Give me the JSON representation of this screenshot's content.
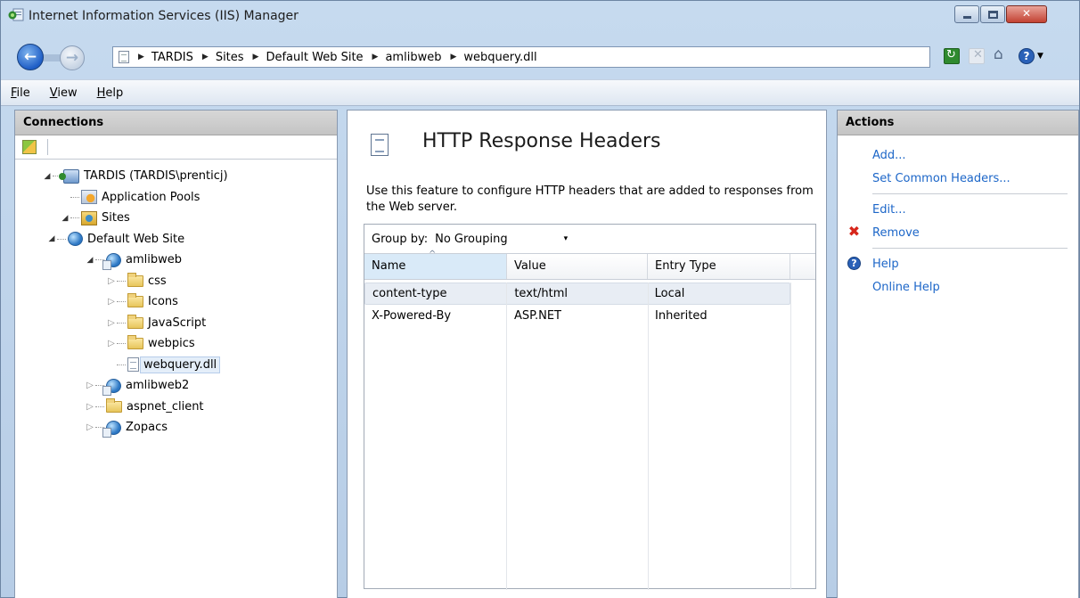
{
  "window": {
    "title": "Internet Information Services (IIS) Manager",
    "controls": {
      "minimize": "",
      "maximize": "",
      "close": "✕"
    }
  },
  "nav": {
    "back_glyph": "←",
    "forward_glyph": "→",
    "breadcrumbs": [
      "TARDIS",
      "Sites",
      "Default Web Site",
      "amlibweb",
      "webquery.dll"
    ],
    "separator_glyph": "▶",
    "tools": [
      "refresh-icon",
      "stop-icon",
      "home-icon",
      "help-icon"
    ]
  },
  "menu": {
    "items": [
      "File",
      "View",
      "Help"
    ],
    "accelerators": [
      "F",
      "V",
      "H"
    ]
  },
  "connections": {
    "header": "Connections",
    "tree": [
      {
        "label": "TARDIS (TARDIS\\prenticj)",
        "indent": 0,
        "twisty": "open",
        "icon": "server"
      },
      {
        "label": "Application Pools",
        "indent": 1,
        "twisty": "none",
        "icon": "pool"
      },
      {
        "label": "Sites",
        "indent": 1,
        "twisty": "open",
        "icon": "sites"
      },
      {
        "label": "Default Web Site",
        "indent": 2,
        "twisty": "open",
        "icon": "globe"
      },
      {
        "label": "amlibweb",
        "indent": 3,
        "twisty": "open",
        "icon": "app"
      },
      {
        "label": "css",
        "indent": 4,
        "twisty": "closed",
        "icon": "folder"
      },
      {
        "label": "Icons",
        "indent": 4,
        "twisty": "closed",
        "icon": "folder"
      },
      {
        "label": "JavaScript",
        "indent": 4,
        "twisty": "closed",
        "icon": "folder"
      },
      {
        "label": "webpics",
        "indent": 4,
        "twisty": "closed",
        "icon": "folder"
      },
      {
        "label": "webquery.dll",
        "indent": 4,
        "twisty": "none",
        "icon": "file",
        "selected": true
      },
      {
        "label": "amlibweb2",
        "indent": 3,
        "twisty": "closed",
        "icon": "app"
      },
      {
        "label": "aspnet_client",
        "indent": 3,
        "twisty": "closed",
        "icon": "folder"
      },
      {
        "label": "Zopacs",
        "indent": 3,
        "twisty": "closed",
        "icon": "app"
      }
    ]
  },
  "feature": {
    "title": "HTTP Response Headers",
    "description": "Use this feature to configure HTTP headers that are added to responses from the Web server.",
    "group_by_label": "Group by:",
    "group_by_value": "No Grouping",
    "group_by_caret": "▾",
    "columns": [
      "Name",
      "Value",
      "Entry Type"
    ],
    "rows": [
      {
        "name": "content-type",
        "value": "text/html",
        "entry_type": "Local"
      },
      {
        "name": "X-Powered-By",
        "value": "ASP.NET",
        "entry_type": "Inherited"
      }
    ]
  },
  "actions": {
    "header": "Actions",
    "groups": [
      [
        {
          "label": "Add...",
          "icon": ""
        },
        {
          "label": "Set Common Headers...",
          "icon": ""
        }
      ],
      [
        {
          "label": "Edit...",
          "icon": ""
        },
        {
          "label": "Remove",
          "icon": "remove-icon"
        }
      ],
      [
        {
          "label": "Help",
          "icon": "help-icon"
        },
        {
          "label": "Online Help",
          "icon": ""
        }
      ]
    ],
    "remove_glyph": "✖",
    "help_glyph": "?"
  },
  "colors": {
    "link": "#1c66c8",
    "header_bg": "#c8c8c8",
    "frame": "#bcd3ea",
    "remove": "#d7261b"
  }
}
